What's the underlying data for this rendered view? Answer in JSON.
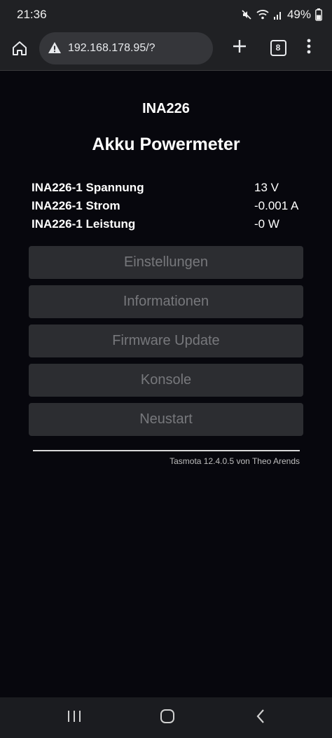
{
  "status_bar": {
    "time": "21:36",
    "battery": "49%"
  },
  "browser": {
    "url": "192.168.178.95/?",
    "tab_count": "8"
  },
  "page": {
    "device_name": "INA226",
    "heading": "Akku Powermeter",
    "readings": [
      {
        "label": "INA226-1 Spannung",
        "value": "13 V"
      },
      {
        "label": "INA226-1 Strom",
        "value": "-0.001 A"
      },
      {
        "label": "INA226-1 Leistung",
        "value": "-0 W"
      }
    ],
    "buttons": [
      "Einstellungen",
      "Informationen",
      "Firmware Update",
      "Konsole",
      "Neustart"
    ],
    "footer": "Tasmota 12.4.0.5 von Theo Arends"
  },
  "colors": {
    "background": "#07070d",
    "button": "#2c2d31",
    "button_text": "#77787c"
  }
}
